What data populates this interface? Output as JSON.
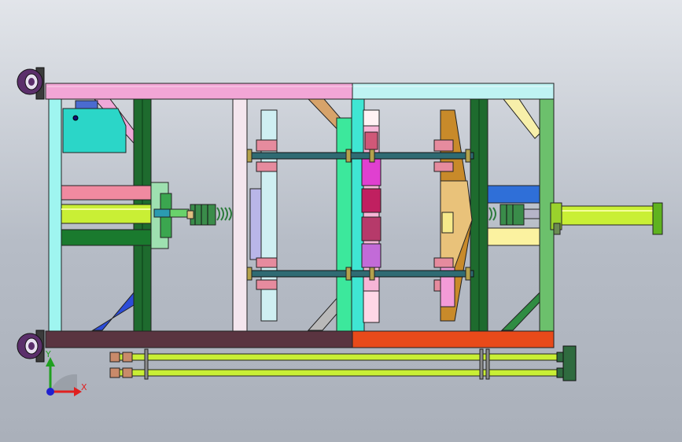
{
  "viewport": {
    "background_top": "#e2e5ea",
    "background_bottom": "#aab0ba"
  },
  "triad": {
    "x_label": "X",
    "y_label": "Y",
    "x_color": "#e02020",
    "y_color": "#20a020",
    "z_color": "#2020d0"
  },
  "model_colors": {
    "top_rail_left": "#f2a6d6",
    "top_rail_right": "#bff3f3",
    "bottom_rail_left": "#5a3440",
    "bottom_rail_right": "#e84a1a",
    "left_post": "#9ff5f0",
    "right_post": "#6cc06c",
    "center_post": "#3ce89c",
    "cylinder": "#c9ef35",
    "dark_green_post": "#1e6b2e",
    "caster": "#5b2f6b",
    "rod": "#2f6b73",
    "cylinder_box": "#2bd6c8"
  }
}
